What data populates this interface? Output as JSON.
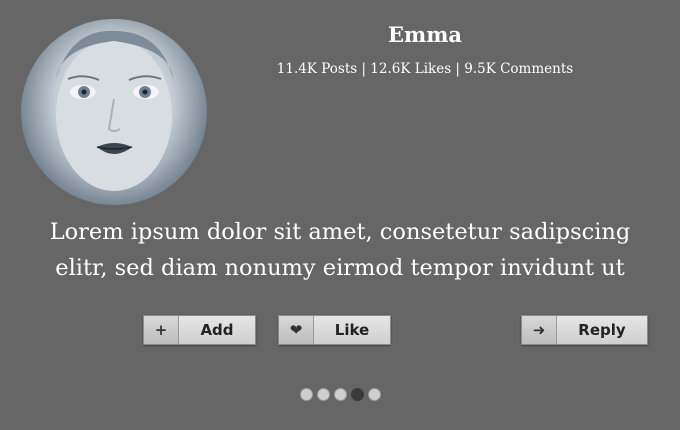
{
  "profile": {
    "name": "Emma",
    "stats": "11.4K Posts | 12.6K Likes | 9.5K Comments",
    "avatar_icon": "profile-photo"
  },
  "message": {
    "line1": "Lorem ipsum dolor sit amet, consetetur sadipscing",
    "line2": "elitr, sed diam nonumy eirmod tempor invidunt ut"
  },
  "actions": {
    "add": {
      "label": "Add",
      "icon": "plus-icon",
      "glyph": "+"
    },
    "like": {
      "label": "Like",
      "icon": "heart-icon",
      "glyph": "❤"
    },
    "reply": {
      "label": "Reply",
      "icon": "arrow-right-icon",
      "glyph": "➜"
    }
  },
  "pagination": {
    "count": 5,
    "active_index": 3
  },
  "colors": {
    "background": "#666666",
    "text": "#ffffff",
    "button": "#d9d9d9",
    "dot": "#cfcfcf",
    "dot_active": "#3a3a3a"
  }
}
